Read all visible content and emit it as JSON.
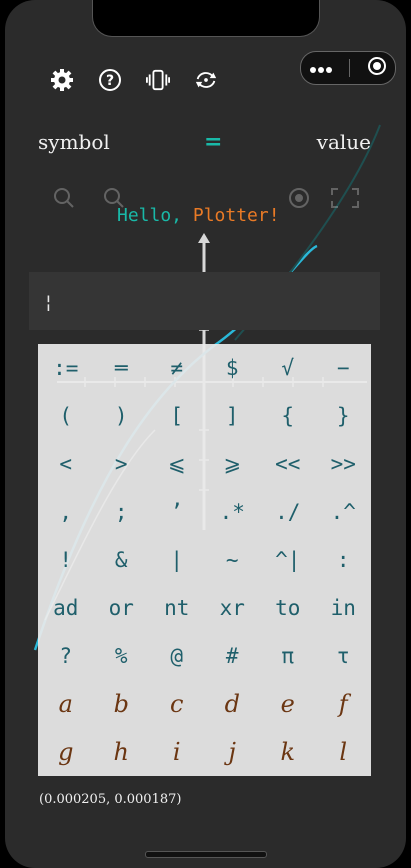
{
  "header": {
    "left": "symbol",
    "middle": "=",
    "right": "value"
  },
  "greeting": {
    "part1": "Hello, ",
    "part2": "Plotter!"
  },
  "input": {
    "cursor": "¦"
  },
  "coordinates": "(0.000205, 0.000187)",
  "toolbar": [
    "gear-icon",
    "help-icon",
    "vibrate-icon",
    "refresh-icon"
  ],
  "capsule": [
    "more-icon",
    "close-target-icon"
  ],
  "colors": {
    "accent": "#19b9a8",
    "orange": "#e97a26",
    "key_text": "#1f5f6b",
    "letter_text": "#6b3612"
  },
  "keyboard": {
    "rows": [
      [
        ":=",
        "═",
        "≠",
        "$",
        "√",
        "−"
      ],
      [
        "(",
        ")",
        "[",
        "]",
        "{",
        "}"
      ],
      [
        "<",
        ">",
        "⩽",
        "⩾",
        "<<",
        ">>"
      ],
      [
        ",",
        ";",
        "’",
        ".*",
        "./",
        ".^"
      ],
      [
        "!",
        "&",
        "|",
        "~",
        "^|",
        ":"
      ],
      [
        "ad",
        "or",
        "nt",
        "xr",
        "to",
        "in"
      ],
      [
        "?",
        "%",
        "@",
        "#",
        "π",
        "τ"
      ],
      [
        "a",
        "b",
        "c",
        "d",
        "e",
        "f"
      ],
      [
        "g",
        "h",
        "i",
        "j",
        "k",
        "l"
      ]
    ]
  }
}
